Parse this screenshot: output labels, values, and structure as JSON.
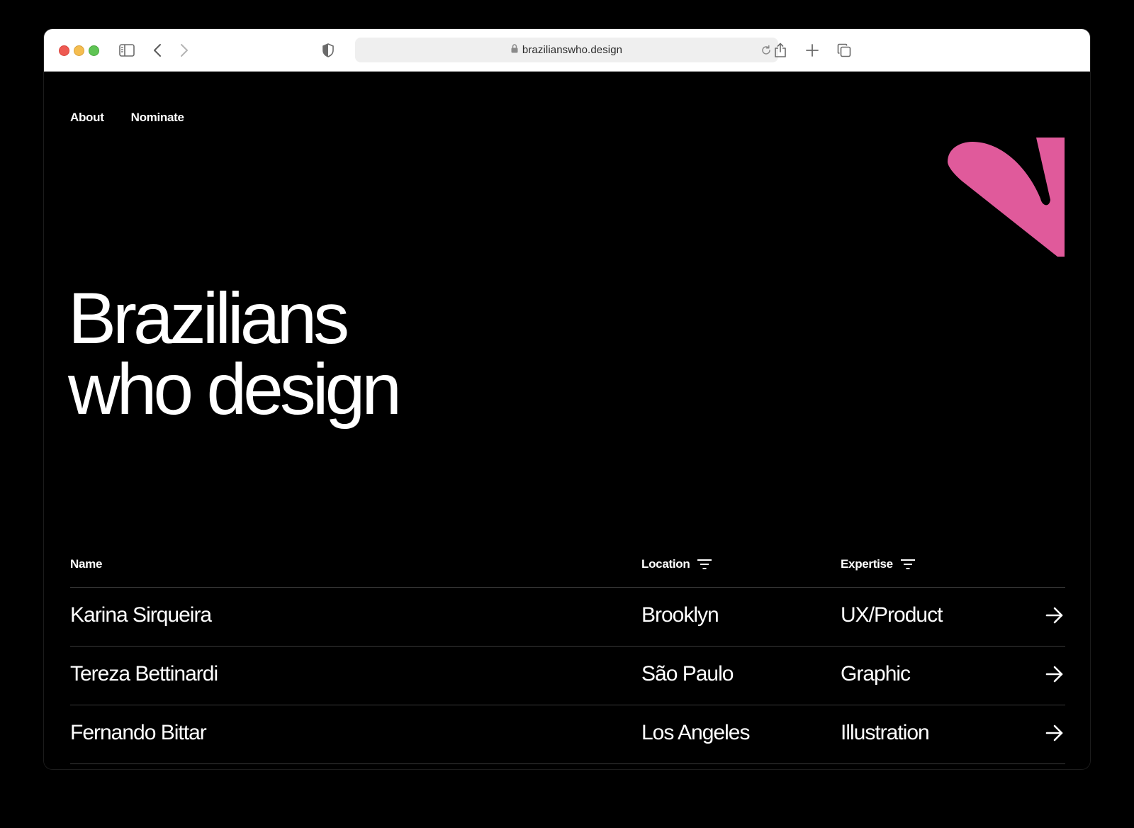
{
  "browser": {
    "url": "braziliansho.design",
    "url_display": "brazilianswho.design"
  },
  "nav": {
    "items": [
      {
        "label": "About"
      },
      {
        "label": "Nominate"
      }
    ]
  },
  "brand": {
    "accent_color": "#E05A9B"
  },
  "hero": {
    "line1": "Brazilians",
    "line2": "who design"
  },
  "table": {
    "headers": {
      "name": "Name",
      "location": "Location",
      "expertise": "Expertise"
    },
    "rows": [
      {
        "name": "Karina Sirqueira",
        "location": "Brooklyn",
        "expertise": "UX/Product"
      },
      {
        "name": "Tereza Bettinardi",
        "location": "São Paulo",
        "expertise": "Graphic"
      },
      {
        "name": "Fernando Bittar",
        "location": "Los Angeles",
        "expertise": "Illustration"
      }
    ]
  }
}
